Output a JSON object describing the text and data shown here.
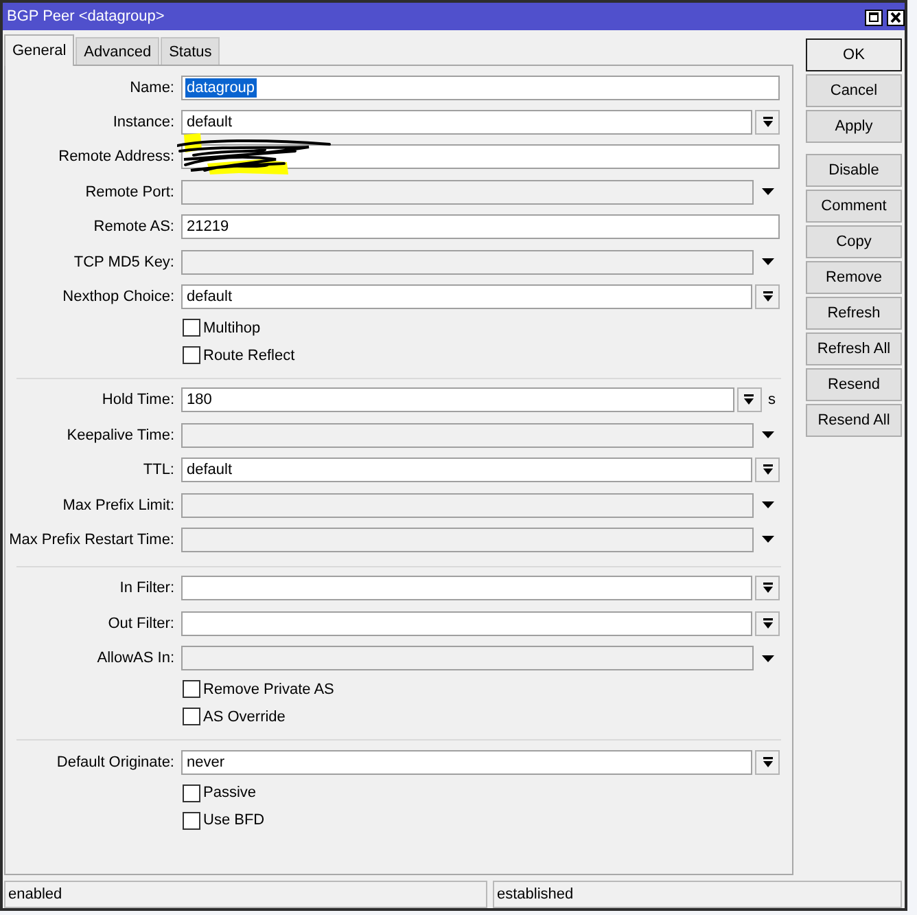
{
  "window": {
    "title": "BGP Peer <datagroup>"
  },
  "tabs": [
    {
      "label": "General",
      "selected": true
    },
    {
      "label": "Advanced",
      "selected": false
    },
    {
      "label": "Status",
      "selected": false
    }
  ],
  "sections": [
    {
      "rows": [
        {
          "kind": "text",
          "label": "Name:",
          "value": "datagroup",
          "highlighted": true
        },
        {
          "kind": "combo",
          "label": "Instance:",
          "value": "default",
          "highlighted": false
        },
        {
          "kind": "text",
          "label": "Remote Address:",
          "scribbled_over": true
        },
        {
          "kind": "unset",
          "label": "Remote Port:"
        },
        {
          "kind": "text",
          "label": "Remote AS:",
          "value": "21219",
          "highlighted": false
        },
        {
          "kind": "unset",
          "label": "TCP MD5 Key:"
        },
        {
          "kind": "combo",
          "label": "Nexthop Choice:",
          "value": "default",
          "highlighted": false
        },
        {
          "kind": "checkbox",
          "label": "Multihop",
          "checked": false
        },
        {
          "kind": "checkbox",
          "label": "Route Reflect",
          "checked": false
        }
      ]
    },
    {
      "rows": [
        {
          "kind": "combo",
          "label": "Hold Time:",
          "value": "180",
          "unit": "s",
          "highlighted": false
        },
        {
          "kind": "unset",
          "label": "Keepalive Time:"
        },
        {
          "kind": "combo",
          "label": "TTL:",
          "value": "default",
          "highlighted": false
        },
        {
          "kind": "unset",
          "label": "Max Prefix Limit:"
        },
        {
          "kind": "unset",
          "label": "Max Prefix Restart Time:"
        }
      ]
    },
    {
      "rows": [
        {
          "kind": "combo",
          "label": "In Filter:"
        },
        {
          "kind": "combo",
          "label": "Out Filter:"
        },
        {
          "kind": "unset",
          "label": "AllowAS In:"
        },
        {
          "kind": "checkbox",
          "label": "Remove Private AS",
          "checked": false
        },
        {
          "kind": "checkbox",
          "label": "AS Override",
          "checked": false
        }
      ]
    },
    {
      "rows": [
        {
          "kind": "combo",
          "label": "Default Originate:",
          "value": "never",
          "highlighted": false
        },
        {
          "kind": "checkbox",
          "label": "Passive",
          "checked": false
        },
        {
          "kind": "checkbox",
          "label": "Use BFD",
          "checked": false
        }
      ]
    }
  ],
  "button_groups": [
    [
      {
        "label": "OK",
        "default": true
      },
      {
        "label": "Cancel",
        "default": false
      },
      {
        "label": "Apply",
        "default": false
      }
    ],
    [
      {
        "label": "Disable",
        "default": false
      },
      {
        "label": "Comment",
        "default": false
      },
      {
        "label": "Copy",
        "default": false
      },
      {
        "label": "Remove",
        "default": false
      },
      {
        "label": "Refresh",
        "default": false
      },
      {
        "label": "Refresh All",
        "default": false
      },
      {
        "label": "Resend",
        "default": false
      },
      {
        "label": "Resend All",
        "default": false
      }
    ]
  ],
  "status_bar": [
    "enabled",
    "established"
  ]
}
